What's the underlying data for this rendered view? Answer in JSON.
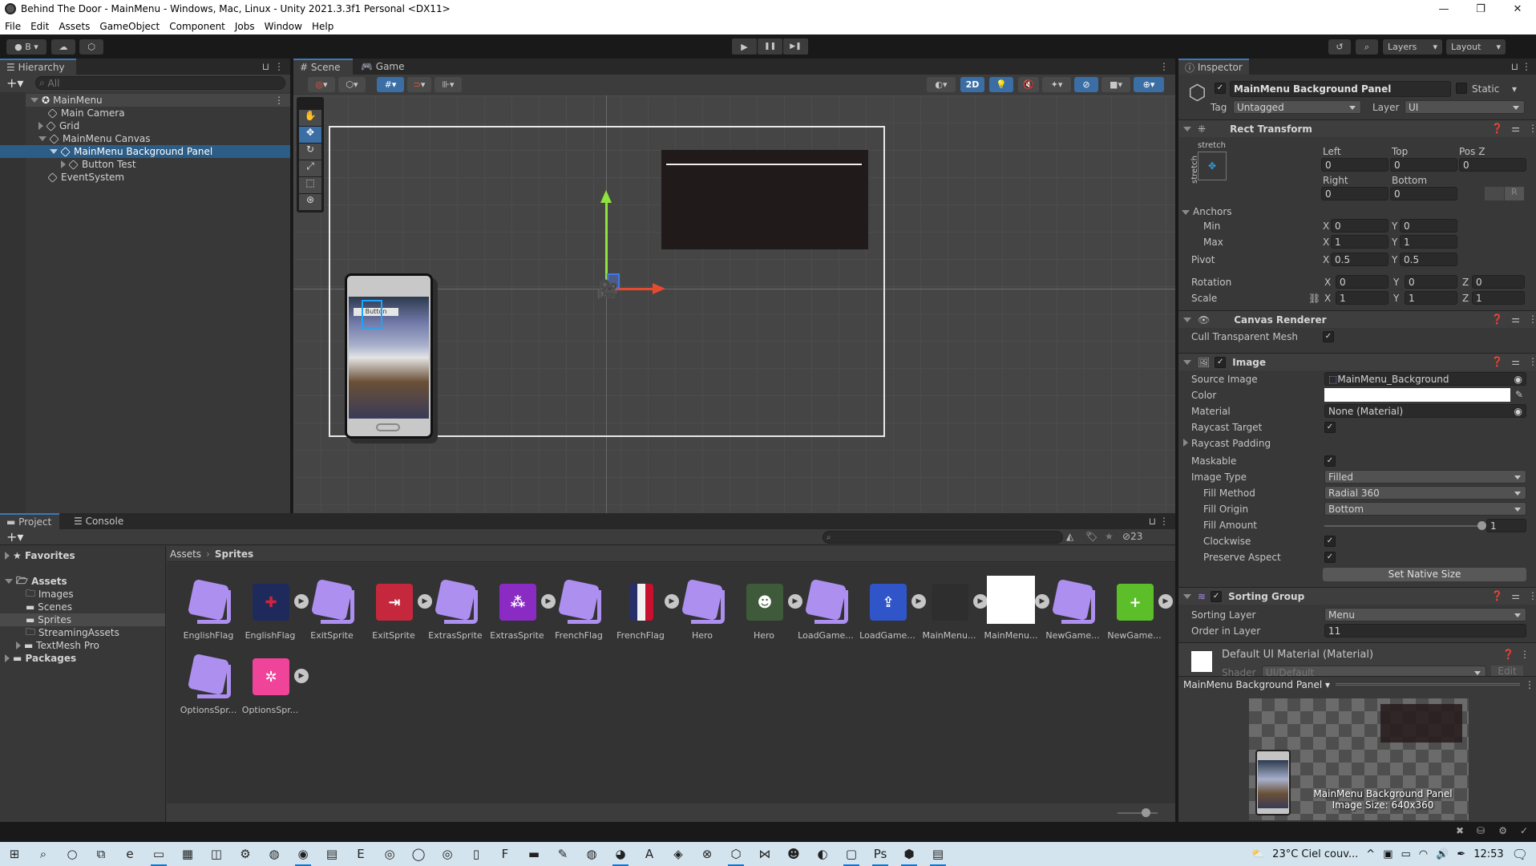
{
  "window": {
    "title": "Behind The Door - MainMenu - Windows, Mac, Linux - Unity 2021.3.3f1 Personal <DX11>",
    "controls": [
      "minimize",
      "restore",
      "close"
    ],
    "control_glyphs": [
      "—",
      "❐",
      "✕"
    ]
  },
  "menu": [
    "File",
    "Edit",
    "Assets",
    "GameObject",
    "Component",
    "Jobs",
    "Window",
    "Help"
  ],
  "toolbar": {
    "account_label": "B",
    "layers_label": "Layers",
    "layout_label": "Layout",
    "play_glyphs": {
      "play": "▶",
      "pause": "❚❚",
      "step": "▶❚"
    }
  },
  "hierarchy": {
    "tab_label": "Hierarchy",
    "search_placeholder": "All",
    "items": [
      {
        "label": "MainMenu",
        "depth": 0,
        "expanded": true,
        "scene": true
      },
      {
        "label": "Main Camera",
        "depth": 1
      },
      {
        "label": "Grid",
        "depth": 1,
        "collapsed": true
      },
      {
        "label": "MainMenu Canvas",
        "depth": 1,
        "expanded": true
      },
      {
        "label": "MainMenu Background Panel",
        "depth": 2,
        "expanded": true,
        "selected": true
      },
      {
        "label": "Button Test",
        "depth": 3,
        "collapsed": true
      },
      {
        "label": "EventSystem",
        "depth": 1
      }
    ]
  },
  "scene": {
    "tabs": [
      {
        "label": "Scene",
        "active": true
      },
      {
        "label": "Game",
        "active": false
      }
    ],
    "mode_2d_label": "2D",
    "phone_button_label": "Button"
  },
  "inspector": {
    "tab_label": "Inspector",
    "object_name": "MainMenu Background Panel",
    "active": true,
    "static_label": "Static",
    "tag_label": "Tag",
    "tag_value": "Untagged",
    "layer_label": "Layer",
    "layer_value": "UI",
    "rect_transform": {
      "title": "Rect Transform",
      "anchor_preset_h": "stretch",
      "anchor_preset_v": "stretch",
      "left_label": "Left",
      "left": "0",
      "top_label": "Top",
      "top": "0",
      "posz_label": "Pos Z",
      "posz": "0",
      "right_label": "Right",
      "right": "0",
      "bottom_label": "Bottom",
      "bottom": "0",
      "r_button": "R",
      "anchors_label": "Anchors",
      "min_label": "Min",
      "min_x": "0",
      "min_y": "0",
      "max_label": "Max",
      "max_x": "1",
      "max_y": "1",
      "pivot_label": "Pivot",
      "pivot_x": "0.5",
      "pivot_y": "0.5",
      "rotation_label": "Rotation",
      "rot_x": "0",
      "rot_y": "0",
      "rot_z": "0",
      "scale_label": "Scale",
      "scale_x": "1",
      "scale_y": "1",
      "scale_z": "1",
      "axis_x": "X",
      "axis_y": "Y",
      "axis_z": "Z"
    },
    "canvas_renderer": {
      "title": "Canvas Renderer",
      "cull_label": "Cull Transparent Mesh",
      "cull": true
    },
    "image": {
      "title": "Image",
      "enabled": true,
      "source_label": "Source Image",
      "source": "MainMenu_Background",
      "color_label": "Color",
      "color": "#ffffff",
      "material_label": "Material",
      "material": "None (Material)",
      "raycast_label": "Raycast Target",
      "raycast": true,
      "raycast_padding_label": "Raycast Padding",
      "maskable_label": "Maskable",
      "maskable": true,
      "image_type_label": "Image Type",
      "image_type": "Filled",
      "fill_method_label": "Fill Method",
      "fill_method": "Radial 360",
      "fill_origin_label": "Fill Origin",
      "fill_origin": "Bottom",
      "fill_amount_label": "Fill Amount",
      "fill_amount": "1",
      "fill_amount_fraction": 1.0,
      "clockwise_label": "Clockwise",
      "clockwise": true,
      "preserve_label": "Preserve Aspect",
      "preserve": true,
      "native_size_button": "Set Native Size"
    },
    "sorting_group": {
      "title": "Sorting Group",
      "enabled": true,
      "layer_label": "Sorting Layer",
      "layer": "Menu",
      "order_label": "Order in Layer",
      "order": "11"
    },
    "material": {
      "title": "Default UI Material (Material)",
      "shader_label": "Shader",
      "shader": "UI/Default",
      "edit_label": "Edit"
    },
    "preview": {
      "title": "MainMenu Background Panel",
      "caption_name": "MainMenu Background Panel",
      "caption_size": "Image Size: 640x360"
    }
  },
  "project": {
    "tabs": [
      {
        "label": "Project",
        "active": true
      },
      {
        "label": "Console",
        "active": false
      }
    ],
    "tree": [
      {
        "label": "Favorites",
        "depth": 0,
        "bold": true,
        "icon": "star"
      },
      {
        "label": "Assets",
        "depth": 0,
        "bold": true,
        "icon": "folder-open"
      },
      {
        "label": "Images",
        "depth": 1,
        "icon": "folder-empty"
      },
      {
        "label": "Scenes",
        "depth": 1,
        "icon": "folder"
      },
      {
        "label": "Sprites",
        "depth": 1,
        "icon": "folder",
        "selected": true
      },
      {
        "label": "StreamingAssets",
        "depth": 1,
        "icon": "folder-empty"
      },
      {
        "label": "TextMesh Pro",
        "depth": 1,
        "icon": "folder"
      },
      {
        "label": "Packages",
        "depth": 0,
        "bold": true,
        "icon": "folder"
      }
    ],
    "breadcrumb": [
      "Assets",
      "Sprites"
    ],
    "hidden_count": "23",
    "assets": [
      {
        "name": "EnglishFlag",
        "type": "prefab"
      },
      {
        "name": "EnglishFlag",
        "type": "sprite",
        "color": "#1f2a5c",
        "glyph": "✚",
        "glyph_color": "#d0233c"
      },
      {
        "name": "ExitSprite",
        "type": "prefab"
      },
      {
        "name": "ExitSprite",
        "type": "sprite",
        "color": "#c5283d",
        "glyph": "⇥"
      },
      {
        "name": "ExtrasSprite",
        "type": "prefab"
      },
      {
        "name": "ExtrasSprite",
        "type": "sprite",
        "color": "#8a2bc4",
        "glyph": "⁂"
      },
      {
        "name": "FrenchFlag",
        "type": "prefab"
      },
      {
        "name": "FrenchFlag",
        "type": "sprite",
        "color": "flag-fr"
      },
      {
        "name": "Hero",
        "type": "prefab"
      },
      {
        "name": "Hero",
        "type": "sprite",
        "color": "#3f5a3a",
        "glyph": "☻"
      },
      {
        "name": "LoadGame...",
        "type": "prefab"
      },
      {
        "name": "LoadGame...",
        "type": "sprite",
        "color": "#2f55c8",
        "glyph": "⇪"
      },
      {
        "name": "MainMenu...",
        "type": "sprite",
        "color": "#2e2e2e",
        "glyph": ""
      },
      {
        "name": "MainMenu...",
        "type": "sprite",
        "color": "#ffffff",
        "glyph": ""
      },
      {
        "name": "NewGame...",
        "type": "prefab"
      },
      {
        "name": "NewGame...",
        "type": "sprite",
        "color": "#5cbf2a",
        "glyph": "+"
      },
      {
        "name": "OptionsSpr...",
        "type": "prefab"
      },
      {
        "name": "OptionsSpr...",
        "type": "sprite",
        "color": "#f0449a",
        "glyph": "✲"
      }
    ]
  },
  "taskbar": {
    "weather": "23°C  Ciel couv...",
    "time": "12:53",
    "apps": [
      "windows",
      "search",
      "cortana",
      "task-view",
      "edge",
      "explorer",
      "store",
      "monitor",
      "settings",
      "app-globe",
      "firefox",
      "news",
      "epic",
      "steam",
      "circle-app",
      "app-rings",
      "office",
      "filezilla",
      "folder",
      "notepad",
      "app-wave",
      "discord",
      "app-translate",
      "app-brain",
      "app-x",
      "unity-hub",
      "visual-studio",
      "gimp",
      "github",
      "app-box",
      "photoshop",
      "unity",
      "app-doc"
    ]
  }
}
